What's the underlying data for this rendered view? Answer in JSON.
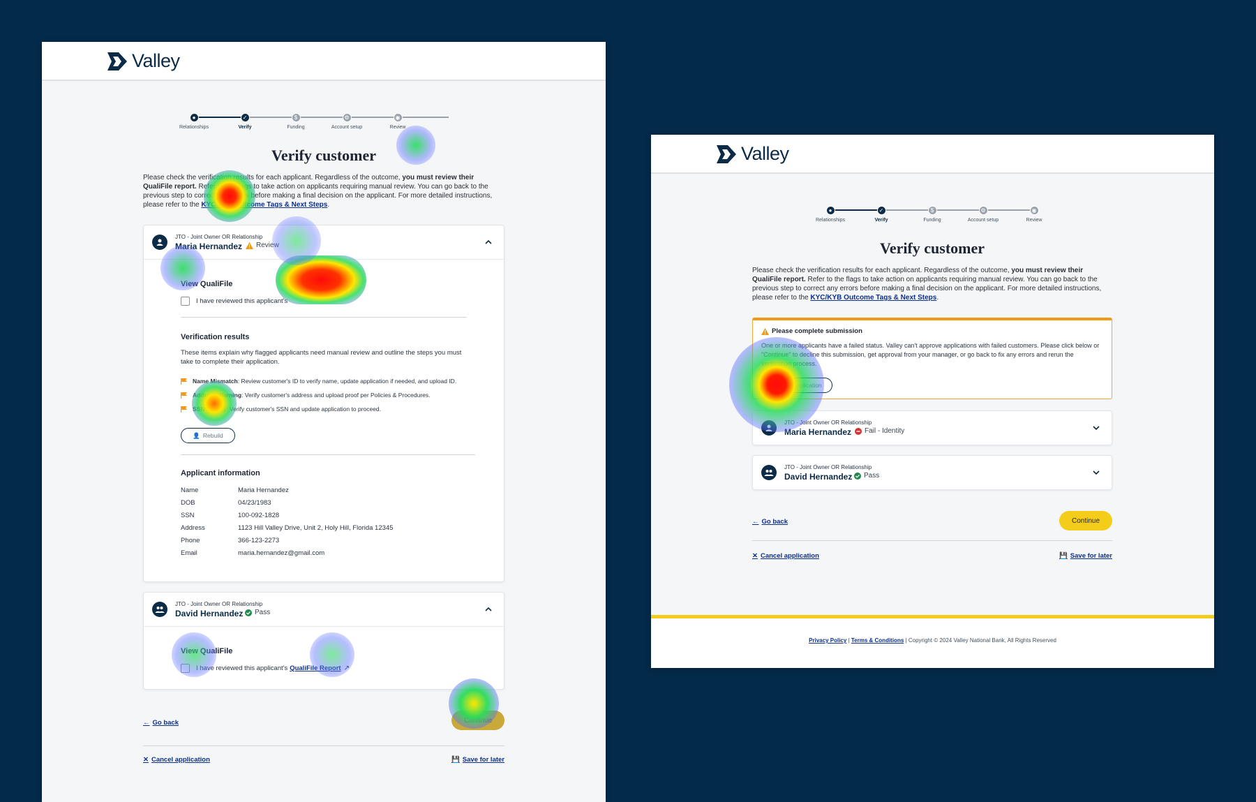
{
  "brand": {
    "name": "Valley"
  },
  "stepper": [
    "Relationships",
    "Verify",
    "Funding",
    "Account setup",
    "Review"
  ],
  "page_title": "Verify customer",
  "intro": {
    "part1": "Please check the verification results for each applicant. Regardless of the outcome, ",
    "bold": "you must review their QualiFile report.",
    "part2": " Refer to the flags to take action on applicants requiring manual review. You can go back to the previous step to correct any errors before making a final decision on the applicant. For more detailed instructions, please refer to the ",
    "link": "KYC/KYB Outcome Tags & Next Steps",
    "end": "."
  },
  "left": {
    "applicant1": {
      "relation": "JTO - Joint Owner OR Relationship",
      "name": "Maria Hernandez",
      "status": "Review",
      "view_qualifile": "View QualiFile",
      "checkbox_label": "I have reviewed this applicant's",
      "verification_title": "Verification results",
      "verification_desc": "These items explain why flagged applicants need manual review and outline the steps you must take to complete their application.",
      "flags": [
        {
          "title": "Name Mismatch",
          "text": ": Review customer's ID to verify name, update application if needed, and upload ID."
        },
        {
          "title": "Address Warning",
          "text": ": Verify customer's address and upload proof per Policies & Procedures."
        },
        {
          "title": "SSN Miskey",
          "text": ": Verify customer's SSN and update application to proceed."
        }
      ],
      "action_button": "Rebuild",
      "info_title": "Applicant information",
      "info": [
        {
          "label": "Name",
          "value": "Maria Hernandez"
        },
        {
          "label": "DOB",
          "value": "04/23/1983"
        },
        {
          "label": "SSN",
          "value": "100-092-1828"
        },
        {
          "label": "Address",
          "value": "1123 Hill Valley Drive, Unit 2, Holy Hill, Florida 12345"
        },
        {
          "label": "Phone",
          "value": "366-123-2273"
        },
        {
          "label": "Email",
          "value": "maria.hernandez@gmail.com"
        }
      ]
    },
    "applicant2": {
      "relation": "JTO - Joint Owner OR Relationship",
      "name": "David Hernandez",
      "status": "Pass",
      "view_qualifile": "View QualiFile",
      "checkbox_label": "I have reviewed this applicant's",
      "report_link": "QualiFile Report"
    },
    "go_back": "Go back",
    "continue": "Continue",
    "cancel": "Cancel application",
    "save": "Save for later"
  },
  "right": {
    "alert_title": "Please complete submission",
    "alert_text": "One or more applicants have a failed status. Valley can't approve applications with failed customers. Please click below or \"Continue\" to decline this submission, get approval from your manager, or go back to fix any errors and rerun the verification process.",
    "alert_button": "Decline application",
    "applicant1": {
      "relation": "JTO - Joint Owner OR Relationship",
      "name": "Maria Hernandez",
      "status": "Fail - Identity"
    },
    "applicant2": {
      "relation": "JTO - Joint Owner OR Relationship",
      "name": "David Hernandez",
      "status": "Pass"
    },
    "go_back": "Go back",
    "continue": "Continue",
    "cancel": "Cancel application",
    "save": "Save for later",
    "footer": {
      "privacy": "Privacy Policy",
      "terms": "Terms & Conditions",
      "copyright": "Copyright © 2024  Valley National Bank, All Rights Reserved"
    }
  },
  "colors": {
    "navy": "#0c2b46",
    "link": "#0d2f8c",
    "yellow": "#f4cc1a",
    "warning": "#f29a15",
    "pass": "#1f8a4c",
    "fail": "#d63232",
    "background": "#042a4a"
  }
}
